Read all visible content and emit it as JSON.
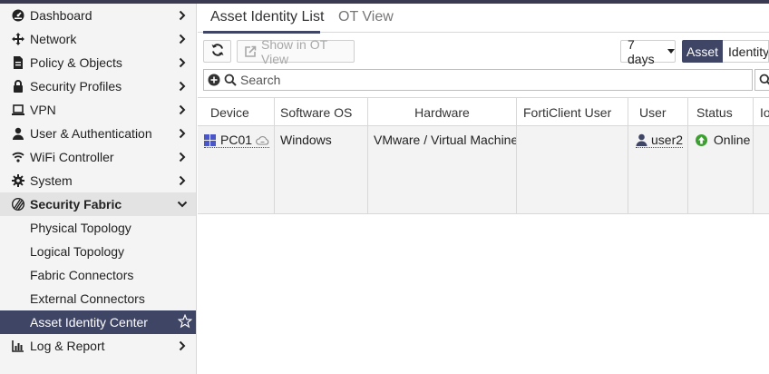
{
  "sidebar": {
    "items": [
      {
        "label": "Dashboard",
        "icon": "dashboard-icon"
      },
      {
        "label": "Network",
        "icon": "network-arrows-icon"
      },
      {
        "label": "Policy & Objects",
        "icon": "policy-icon"
      },
      {
        "label": "Security Profiles",
        "icon": "lock-icon"
      },
      {
        "label": "VPN",
        "icon": "laptop-icon"
      },
      {
        "label": "User & Authentication",
        "icon": "user-icon"
      },
      {
        "label": "WiFi Controller",
        "icon": "wifi-icon"
      },
      {
        "label": "System",
        "icon": "gear-icon"
      },
      {
        "label": "Security Fabric",
        "icon": "fabric-icon"
      }
    ],
    "sub_items": [
      {
        "label": "Physical Topology"
      },
      {
        "label": "Logical Topology"
      },
      {
        "label": "Fabric Connectors"
      },
      {
        "label": "External Connectors"
      },
      {
        "label": "Asset Identity Center"
      }
    ],
    "last_item": {
      "label": "Log & Report",
      "icon": "chart-icon"
    }
  },
  "tabs": [
    {
      "label": "Asset Identity List"
    },
    {
      "label": "OT View"
    }
  ],
  "toolbar": {
    "show_ot_label": "Show in OT View",
    "range_label": "7 days",
    "asset_label": "Asset",
    "identity_label": "Identity"
  },
  "search": {
    "placeholder": "Search"
  },
  "table": {
    "columns": [
      "Device",
      "Software OS",
      "Hardware",
      "FortiClient User",
      "User",
      "Status",
      "Io"
    ],
    "rows": [
      {
        "device": "PC01",
        "os": "Windows",
        "hardware": "VMware / Virtual Machine",
        "forticlient_user": "",
        "user": "user2",
        "status": "Online"
      }
    ]
  },
  "colors": {
    "accent": "#3f4565",
    "online": "#3aa02e",
    "windows": "#4a56c8"
  }
}
